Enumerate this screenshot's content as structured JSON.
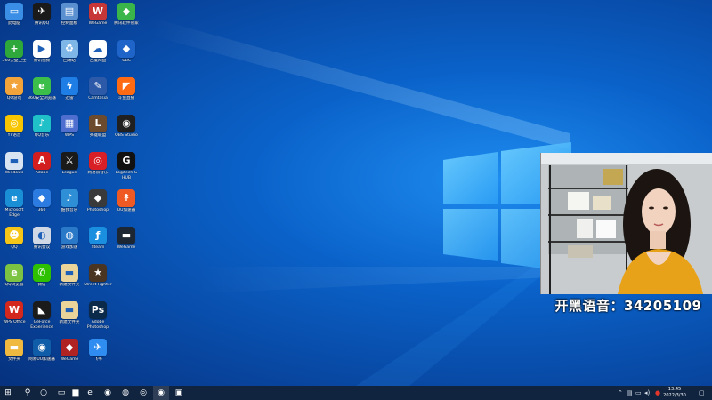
{
  "colors": {
    "wallpaper": "#0a62c9",
    "taskbar": "#10243f",
    "accent": "#0078d7"
  },
  "desktop": {
    "icons": [
      {
        "label": "此电脑",
        "icon": "computer-icon",
        "color": "#3a8ee6"
      },
      {
        "label": "腾讯QQ",
        "icon": "qq-penguin-icon",
        "color": "#1a1a1a"
      },
      {
        "label": "控制面板",
        "icon": "control-panel-icon",
        "color": "#5a8fd0"
      },
      {
        "label": "WeGame",
        "icon": "wegame-icon",
        "color": "#c83737"
      },
      {
        "label": "腾讯软件管家",
        "icon": "app-icon",
        "color": "#3ab54a"
      },
      {
        "label": "360安全卫士",
        "icon": "shield-plus-icon",
        "color": "#2ea83a"
      },
      {
        "label": "腾讯视频",
        "icon": "video-icon",
        "color": "#ffffff"
      },
      {
        "label": "回收站",
        "icon": "recycle-bin-icon",
        "color": "#7fb6e8"
      },
      {
        "label": "百度网盘",
        "icon": "cloud-drive-icon",
        "color": "#ffffff"
      },
      {
        "label": "OBS",
        "icon": "app-icon",
        "color": "#1f64c9"
      },
      {
        "label": "QQ游戏",
        "icon": "game-icon",
        "color": "#f2a33a"
      },
      {
        "label": "360安全浏览器",
        "icon": "browser-icon",
        "color": "#3cbf4a"
      },
      {
        "label": "迅雷",
        "icon": "thunder-icon",
        "color": "#1e7ee6"
      },
      {
        "label": "Camtasia",
        "icon": "pen-icon",
        "color": "#2d5aa8"
      },
      {
        "label": "斗鱼直播",
        "icon": "live-icon",
        "color": "#ff6a13"
      },
      {
        "label": "YY语音",
        "icon": "yy-icon",
        "color": "#f7c600"
      },
      {
        "label": "QQ音乐",
        "icon": "music-icon",
        "color": "#1fc0c8"
      },
      {
        "label": "WPS",
        "icon": "office-icon",
        "color": "#4f6fd0"
      },
      {
        "label": "英雄联盟",
        "icon": "lol-icon",
        "color": "#6b4a2e"
      },
      {
        "label": "OBS Studio",
        "icon": "obs-icon",
        "color": "#202020"
      },
      {
        "label": "Windows",
        "icon": "monitor-icon",
        "color": "#d8e4f2"
      },
      {
        "label": "Adobe",
        "icon": "adobe-icon",
        "color": "#d21e1e"
      },
      {
        "label": "League",
        "icon": "league-icon",
        "color": "#1a1a1a"
      },
      {
        "label": "网易云音乐",
        "icon": "netease-music-icon",
        "color": "#d91f26"
      },
      {
        "label": "Logitech G HUB",
        "icon": "logitech-icon",
        "color": "#111111"
      },
      {
        "label": "Microsoft Edge",
        "icon": "edge-icon",
        "color": "#1b8fd6"
      },
      {
        "label": "360",
        "icon": "app-icon",
        "color": "#2c7be0"
      },
      {
        "label": "酷我音乐",
        "icon": "music-icon",
        "color": "#2e8fd6"
      },
      {
        "label": "Photoshop",
        "icon": "app-icon",
        "color": "#3a3a3a"
      },
      {
        "label": "UU加速器",
        "icon": "accelerator-icon",
        "color": "#ef5a24"
      },
      {
        "label": "QQ",
        "icon": "chat-icon",
        "color": "#f5c518"
      },
      {
        "label": "腾讯会议",
        "icon": "meeting-icon",
        "color": "#cfd8e4"
      },
      {
        "label": "游戏加速",
        "icon": "globe-icon",
        "color": "#2a79c9"
      },
      {
        "label": "Steam",
        "icon": "steam-icon",
        "color": "#1a8fe0"
      },
      {
        "label": "WeGame",
        "icon": "folder-icon",
        "color": "#1d2733"
      },
      {
        "label": "QQ浏览器",
        "icon": "browser-icon",
        "color": "#7cc343"
      },
      {
        "label": "微信",
        "icon": "wechat-icon",
        "color": "#2dc100"
      },
      {
        "label": "新建文件夹",
        "icon": "folder-icon",
        "color": "#ead49a"
      },
      {
        "label": "Street Fighter",
        "icon": "game-icon",
        "color": "#4a3522"
      },
      {
        "label": "WPS Office",
        "icon": "wps-icon",
        "color": "#d4271e"
      },
      {
        "label": "GeForce Experience",
        "icon": "nvidia-icon",
        "color": "#1b1b1b"
      },
      {
        "label": "新建文件夹",
        "icon": "folder-icon",
        "color": "#ead49a"
      },
      {
        "label": "Adobe Photoshop",
        "icon": "photoshop-icon",
        "color": "#0b2a4a"
      },
      {
        "label": "文件夹",
        "icon": "folder-icon",
        "color": "#f0b940"
      },
      {
        "label": "网易UU加速器",
        "icon": "uu-icon",
        "color": "#0f5ca8"
      },
      {
        "label": "WeGame",
        "icon": "app-icon",
        "color": "#b02323"
      },
      {
        "label": "飞书",
        "icon": "feishu-icon",
        "color": "#2f8cf0"
      }
    ]
  },
  "stream_overlay": {
    "caption": "开黑语音：34205109"
  },
  "taskbar": {
    "apps": [
      {
        "icon": "windows-start-icon",
        "glyph": "⊞"
      },
      {
        "icon": "search-icon",
        "glyph": "⚲"
      },
      {
        "icon": "cortana-icon",
        "glyph": "○"
      },
      {
        "icon": "task-view-icon",
        "glyph": "▭"
      },
      {
        "icon": "file-explorer-icon",
        "glyph": "▆"
      },
      {
        "icon": "edge-icon",
        "glyph": "e"
      },
      {
        "icon": "browser-icon",
        "glyph": "◉"
      },
      {
        "icon": "app-icon",
        "glyph": "◍"
      },
      {
        "icon": "yy-icon",
        "glyph": "◎"
      },
      {
        "icon": "obs-icon",
        "glyph": "◉"
      },
      {
        "icon": "app-icon",
        "glyph": "▣"
      }
    ],
    "clock": {
      "time": "13:45",
      "date": "2022/3/30"
    }
  }
}
